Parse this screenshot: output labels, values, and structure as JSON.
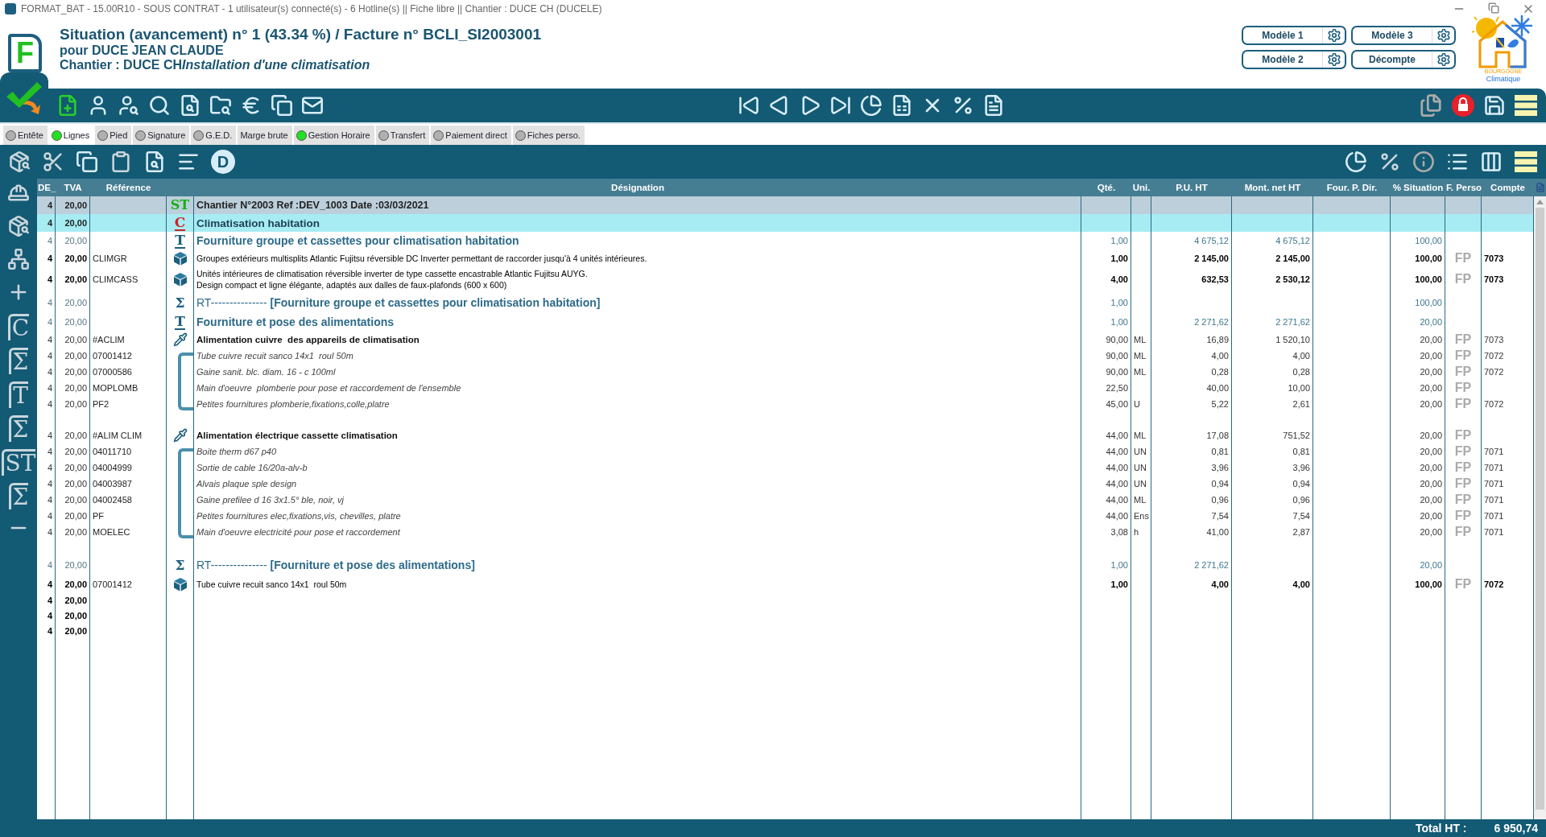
{
  "title_bar": {
    "text": "FORMAT_BAT - 15.00R10 - SOUS CONTRAT - 1 utilisateur(s) connecté(s) - 6 Hotline(s) || Fiche libre || Chantier : DUCE CH (DUCELE)"
  },
  "header": {
    "logo_letter": "F",
    "title": "Situation (avancement) n° 1 (43.34 %) / Facture n° BCLI_SI2003001",
    "client": "pour DUCE JEAN CLAUDE",
    "site_label": "Chantier : DUCE CH",
    "site_name": "Installation d'une climatisation"
  },
  "model_buttons": [
    "Modèle 1",
    "Modèle 3",
    "Modèle 2",
    "Décompte"
  ],
  "brand": {
    "line1": "BOURGOGNE",
    "line2": "Climatique"
  },
  "tabs": [
    {
      "label": "Entête",
      "selected": false,
      "lit": false
    },
    {
      "label": "Lignes",
      "selected": true,
      "lit": true
    },
    {
      "label": "Pied",
      "selected": false,
      "lit": false
    },
    {
      "label": "Signature",
      "selected": false,
      "lit": false
    },
    {
      "label": "G.E.D.",
      "selected": false,
      "lit": false
    },
    {
      "label": "Marge brute",
      "selected": false
    },
    {
      "label": "Gestion Horaire",
      "selected": false,
      "lit": true
    },
    {
      "label": "Transfert",
      "selected": false,
      "lit": false
    },
    {
      "label": "Paiement direct",
      "selected": false,
      "lit": false
    },
    {
      "label": "Fiches perso.",
      "selected": false,
      "lit": false
    }
  ],
  "edit_toolbar": {
    "letter_button": "D"
  },
  "sidebar_tools": [
    {
      "kind": "worker"
    },
    {
      "kind": "find"
    },
    {
      "kind": "tree"
    },
    {
      "kind": "insert"
    },
    {
      "kind": "glyph",
      "glyph": "C"
    },
    {
      "kind": "glyph",
      "glyph": "Σ"
    },
    {
      "kind": "glyph",
      "glyph": "T"
    },
    {
      "kind": "glyph",
      "glyph": "Σ"
    },
    {
      "kind": "glyph",
      "glyph": "ST"
    },
    {
      "kind": "glyph",
      "glyph": "Σ"
    },
    {
      "kind": "remove"
    }
  ],
  "table": {
    "columns": [
      "DE_",
      "TVA",
      "Référence",
      "Désignation",
      "Qté.",
      "Uni.",
      "P.U. HT",
      "Mont. net HT",
      "Four. P. Dir.",
      "% Situation",
      "F. Perso",
      "Compte"
    ],
    "rows": [
      {
        "kind": "st",
        "mark": "ST",
        "c1": "4",
        "tva": "20,00",
        "designation": "Chantier N°2003 Ref :DEV_1003 Date :03/03/2021"
      },
      {
        "kind": "c",
        "mark": "C",
        "c1": "4",
        "tva": "20,00",
        "designation": "Climatisation habitation"
      },
      {
        "kind": "t",
        "mark": "T",
        "c1": "4",
        "tva": "20,00",
        "designation": "Fourniture groupe et cassettes pour climatisation habitation",
        "qte": "1,00",
        "pu": "4 675,12",
        "mont": "4 675,12",
        "sit": "100,00"
      },
      {
        "kind": "article",
        "c1": "4",
        "tva": "20,00",
        "ref": "CLIMGR",
        "designation": "Groupes extérieurs multisplits Atlantic Fujitsu réversible DC Inverter permettant de raccorder jusqu'à 4 unités intérieures.",
        "qte": "1,00",
        "pu": "2 145,00",
        "mont": "2 145,00",
        "sit": "100,00",
        "fp": "FP",
        "compte": "7073"
      },
      {
        "kind": "article",
        "c1": "4",
        "tva": "20,00",
        "ref": "CLIMCASS",
        "designation": "Unités intérieures de climatisation réversible inverter de type cassette encastrable Atlantic Fujitsu AUYG.\nDesign compact et ligne élégante, adaptés aux dalles de faux-plafonds (600 x 600)",
        "qte": "4,00",
        "pu": "632,53",
        "mont": "2 530,12",
        "sit": "100,00",
        "fp": "FP",
        "compte": "7073"
      },
      {
        "kind": "sum",
        "mark": "Σ",
        "c1": "4",
        "tva": "20,00",
        "designation": "RT--------------- **[Fourniture groupe et cassettes pour climatisation habitation]**",
        "qte": "1,00",
        "sit": "100,00"
      },
      {
        "kind": "t",
        "mark": "T",
        "c1": "4",
        "tva": "20,00",
        "designation": "Fourniture et pose des alimentations",
        "qte": "1,00",
        "pu": "2 271,62",
        "mont": "2 271,62",
        "sit": "20,00"
      },
      {
        "kind": "ouvrage",
        "c1": "4",
        "tva": "20,00",
        "ref": "#ACLIM",
        "designation": "Alimentation cuivre  des appareils de climatisation",
        "qte": "90,00",
        "uni": "ML",
        "pu": "16,89",
        "mont": "1 520,10",
        "sit": "20,00",
        "fp": "FP",
        "compte": "7073"
      },
      {
        "kind": "component",
        "c1": "4",
        "tva": "20,00",
        "ref": "07001412",
        "designation": "Tube cuivre recuit sanco 14x1  roul 50m",
        "qte": "90,00",
        "uni": "ML",
        "pu": "4,00",
        "mont": "4,00",
        "sit": "20,00",
        "fp": "FP",
        "compte": "7072"
      },
      {
        "kind": "component",
        "c1": "4",
        "tva": "20,00",
        "ref": "07000586",
        "designation": "Gaine sanit. blc. diam. 16 - c 100ml",
        "qte": "90,00",
        "uni": "ML",
        "pu": "0,28",
        "mont": "0,28",
        "sit": "20,00",
        "fp": "FP",
        "compte": "7072"
      },
      {
        "kind": "component",
        "c1": "4",
        "tva": "20,00",
        "ref": "MOPLOMB",
        "designation": "Main d'oeuvre  plomberie pour pose et raccordement de l'ensemble",
        "qte": "22,50",
        "pu": "40,00",
        "mont": "10,00",
        "sit": "20,00",
        "fp": "FP"
      },
      {
        "kind": "component",
        "c1": "4",
        "tva": "20,00",
        "ref": "PF2",
        "designation": "Petites fournitures plomberie,fixations,colle,platre",
        "qte": "45,00",
        "uni": "U",
        "pu": "5,22",
        "mont": "2,61",
        "sit": "20,00",
        "fp": "FP",
        "compte": "7072"
      },
      {
        "kind": "spacer"
      },
      {
        "kind": "ouvrage",
        "c1": "4",
        "tva": "20,00",
        "ref": "#ALIM CLIM",
        "designation": "Alimentation électrique cassette climatisation",
        "qte": "44,00",
        "uni": "ML",
        "pu": "17,08",
        "mont": "751,52",
        "sit": "20,00",
        "fp": "FP"
      },
      {
        "kind": "component",
        "c1": "4",
        "tva": "20,00",
        "ref": "04011710",
        "designation": "Boite therm d67 p40",
        "qte": "44,00",
        "uni": "UN",
        "pu": "0,81",
        "mont": "0,81",
        "sit": "20,00",
        "fp": "FP",
        "compte": "7071"
      },
      {
        "kind": "component",
        "c1": "4",
        "tva": "20,00",
        "ref": "04004999",
        "designation": "Sortie de cable 16/20a-alv-b",
        "qte": "44,00",
        "uni": "UN",
        "pu": "3,96",
        "mont": "3,96",
        "sit": "20,00",
        "fp": "FP",
        "compte": "7071"
      },
      {
        "kind": "component",
        "c1": "4",
        "tva": "20,00",
        "ref": "04003987",
        "designation": "Alvais plaque sple design",
        "qte": "44,00",
        "uni": "UN",
        "pu": "0,94",
        "mont": "0,94",
        "sit": "20,00",
        "fp": "FP",
        "compte": "7071"
      },
      {
        "kind": "component",
        "c1": "4",
        "tva": "20,00",
        "ref": "04002458",
        "designation": "Gaine prefilee d 16 3x1.5° ble, noir, vj",
        "qte": "44,00",
        "uni": "ML",
        "pu": "0,96",
        "mont": "0,96",
        "sit": "20,00",
        "fp": "FP",
        "compte": "7071"
      },
      {
        "kind": "component",
        "c1": "4",
        "tva": "20,00",
        "ref": "PF",
        "designation": "Petites fournitures elec,fixations,vis, chevilles, platre",
        "qte": "44,00",
        "uni": "Ens",
        "pu": "7,54",
        "mont": "7,54",
        "sit": "20,00",
        "fp": "FP",
        "compte": "7071"
      },
      {
        "kind": "component",
        "c1": "4",
        "tva": "20,00",
        "ref": "MOELEC",
        "designation": "Main d'oeuvre electricité pour pose et raccordement",
        "qte": "3,08",
        "uni": "h",
        "pu": "41,00",
        "mont": "2,87",
        "sit": "20,00",
        "fp": "FP",
        "compte": "7071"
      },
      {
        "kind": "spacer"
      },
      {
        "kind": "sum",
        "mark": "Σ",
        "c1": "4",
        "tva": "20,00",
        "designation": "RT--------------- **[Fourniture et pose des alimentations]**",
        "qte": "1,00",
        "pu": "2 271,62",
        "sit": "20,00"
      },
      {
        "kind": "article",
        "c1": "4",
        "tva": "20,00",
        "ref": "07001412",
        "designation": "Tube cuivre recuit sanco 14x1  roul 50m",
        "qte": "1,00",
        "pu": "4,00",
        "mont": "4,00",
        "sit": "100,00",
        "fp": "FP",
        "compte": "7072"
      },
      {
        "kind": "blank",
        "c1": "4",
        "tva": "20,00"
      },
      {
        "kind": "blank",
        "c1": "4",
        "tva": "20,00"
      },
      {
        "kind": "blank",
        "c1": "4",
        "tva": "20,00"
      }
    ]
  },
  "footer": {
    "label": "Total HT :",
    "value": "6 950,74"
  }
}
